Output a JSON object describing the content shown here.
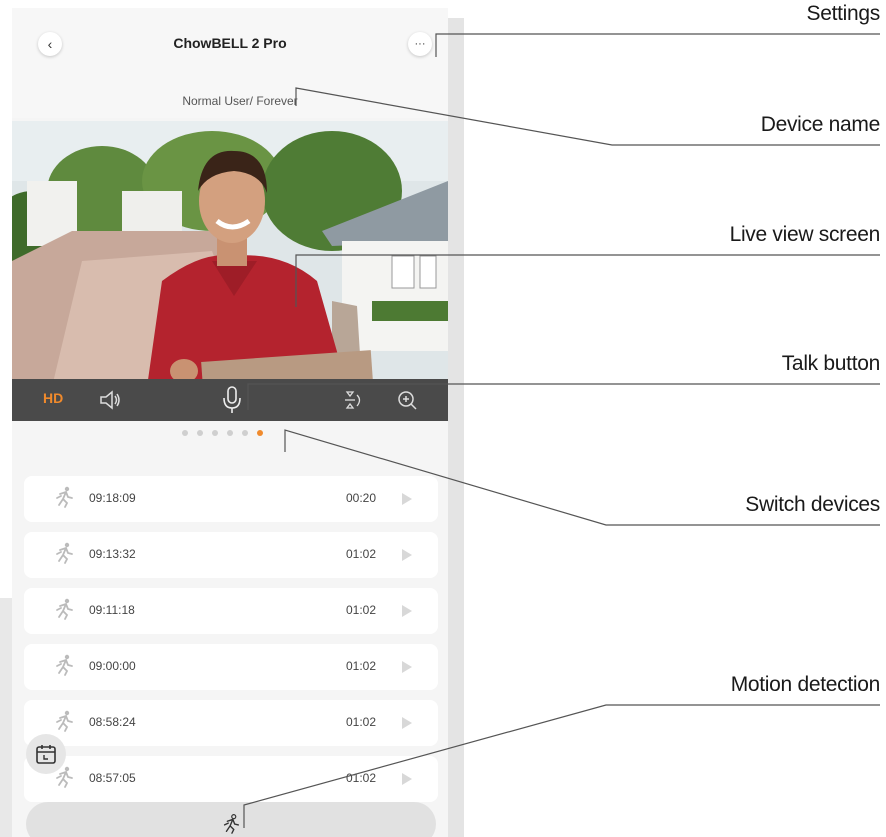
{
  "app": {
    "title": "ChowBELL 2 Pro",
    "subtitle": "Normal User/ Forever",
    "back_glyph": "‹",
    "more_glyph": "···"
  },
  "toolbar": {
    "hd_label": "HD",
    "icons": [
      "speaker-icon",
      "microphone-icon",
      "flip-icon",
      "zoom-in-icon"
    ]
  },
  "pager": {
    "count": 6,
    "active_index": 5
  },
  "recordings": [
    {
      "time": "09:18:09",
      "duration": "00:20"
    },
    {
      "time": "09:13:32",
      "duration": "01:02"
    },
    {
      "time": "09:11:18",
      "duration": "01:02"
    },
    {
      "time": "09:00:00",
      "duration": "01:02"
    },
    {
      "time": "08:58:24",
      "duration": "01:02"
    },
    {
      "time": "08:57:05",
      "duration": "01:02"
    }
  ],
  "annotations": {
    "settings": "Settings",
    "device_name": "Device name",
    "live_view": "Live view screen",
    "talk": "Talk button",
    "switch": "Switch devices",
    "motion": "Motion detection"
  },
  "colors": {
    "accent": "#f08a2c",
    "toolbar_bg": "#4a4a4a",
    "line": "#555555"
  }
}
